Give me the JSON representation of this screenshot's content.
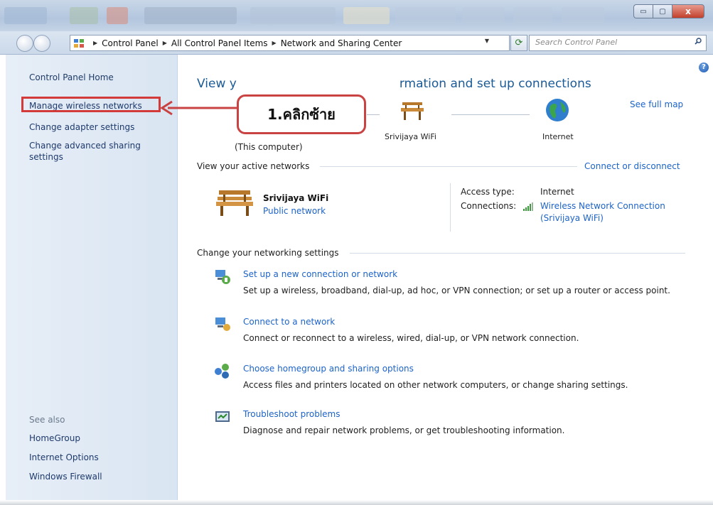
{
  "window": {
    "controls": {
      "minimize": "▭",
      "maximize": "▢",
      "close": "x"
    }
  },
  "address_bar": {
    "crumbs": [
      "Control Panel",
      "All Control Panel Items",
      "Network and Sharing Center"
    ],
    "search_placeholder": "Search Control Panel"
  },
  "sidebar": {
    "home": "Control Panel Home",
    "links": [
      "Manage wireless networks",
      "Change adapter settings",
      "Change advanced sharing",
      "settings"
    ],
    "see_also_title": "See also",
    "see_also": [
      "HomeGroup",
      "Internet Options",
      "Windows Firewall"
    ]
  },
  "main": {
    "title_left": "View y",
    "title_right": "rmation and set up connections",
    "see_full_map": "See full map",
    "map": {
      "computer_label": "(This computer)",
      "network_label": "Srivijaya WiFi",
      "internet_label": "Internet"
    },
    "active_networks": {
      "heading": "View your active networks",
      "connect_link": "Connect or disconnect",
      "network_name": "Srivijaya WiFi",
      "network_type": "Public network",
      "access_type_label": "Access type:",
      "access_type_value": "Internet",
      "connections_label": "Connections:",
      "connection_line1": "Wireless Network Connection",
      "connection_line2": "(Srivijaya WiFi)"
    },
    "settings_heading": "Change your networking settings",
    "tasks": [
      {
        "title": "Set up a new connection or network",
        "desc": "Set up a wireless, broadband, dial-up, ad hoc, or VPN connection; or set up a router or access point."
      },
      {
        "title": "Connect to a network",
        "desc": "Connect or reconnect to a wireless, wired, dial-up, or VPN network connection."
      },
      {
        "title": "Choose homegroup and sharing options",
        "desc": "Access files and printers located on other network computers, or change sharing settings."
      },
      {
        "title": "Troubleshoot problems",
        "desc": "Diagnose and repair network problems, or get troubleshooting information."
      }
    ]
  },
  "annotation": {
    "callout_text": "1.คลิกซ้าย"
  },
  "colors": {
    "link": "#1c63c9",
    "highlight_red": "#d33a3a",
    "title_blue": "#1a5a96"
  },
  "icons": {
    "nav_back": "back-arrow-icon",
    "nav_forward": "forward-arrow-icon",
    "refresh": "refresh-icon",
    "search": "search-icon",
    "help": "help-icon",
    "bench": "bench-network-icon",
    "globe": "globe-icon",
    "signal": "signal-bars-icon"
  }
}
